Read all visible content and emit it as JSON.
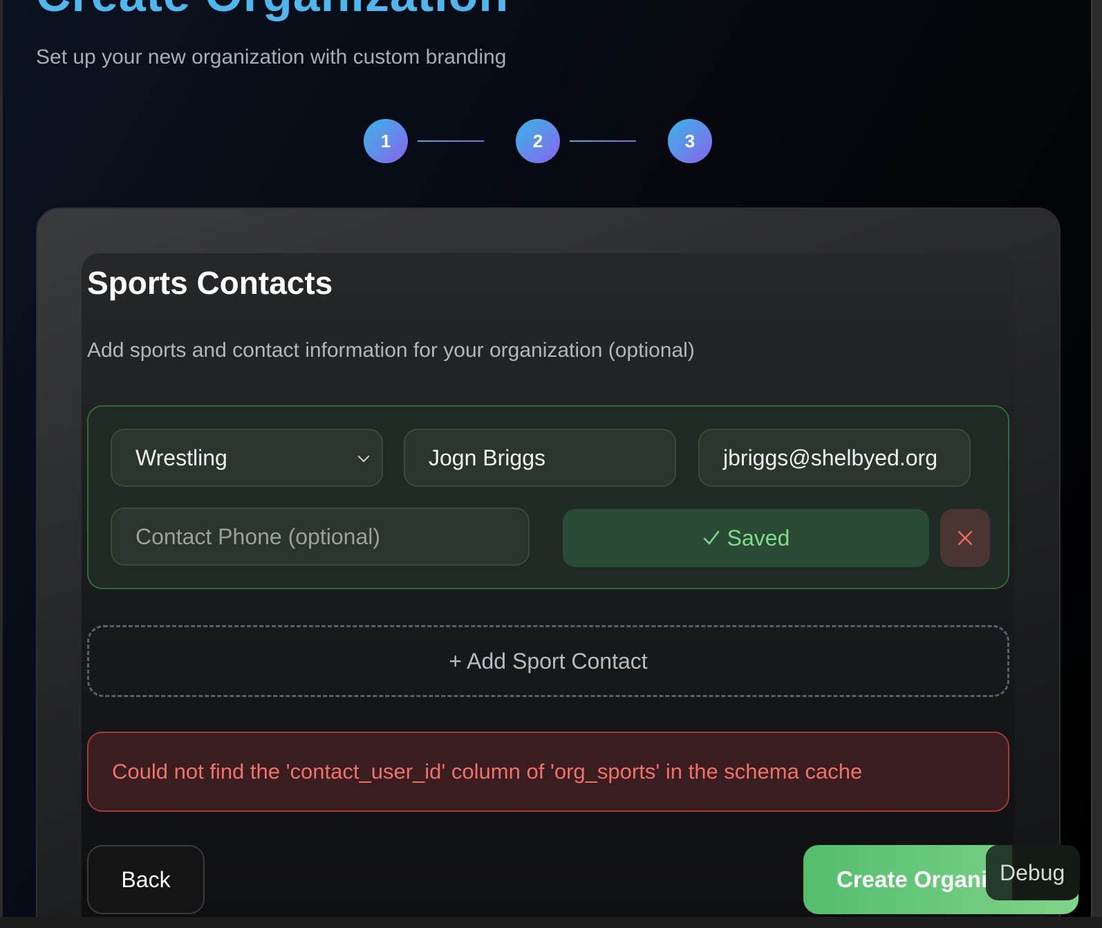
{
  "header": {
    "title": "Create Organization",
    "subtitle": "Set up your new organization with custom branding"
  },
  "steps": [
    "1",
    "2",
    "3"
  ],
  "section": {
    "title": "Sports Contacts",
    "description": "Add sports and contact information for your organization (optional)"
  },
  "contact": {
    "sport": "Wrestling",
    "name": "Jogn Briggs",
    "email": "jbriggs@shelbyed.org",
    "phone_placeholder": "Contact Phone (optional)",
    "saved_label": "Saved",
    "saved_icon": "check-icon",
    "remove_icon": "close-icon"
  },
  "add_contact_label": "+ Add Sport Contact",
  "error_message": "Could not find the 'contact_user_id' column of 'org_sports' in the schema cache",
  "footer": {
    "back_label": "Back",
    "create_label": "Create Organization",
    "debug_label": "Debug"
  },
  "colors": {
    "accent_blue": "#4fb6ee",
    "accent_purple": "#8a63ec",
    "success_green": "#7fdc8e",
    "error_red": "#f0716b"
  }
}
